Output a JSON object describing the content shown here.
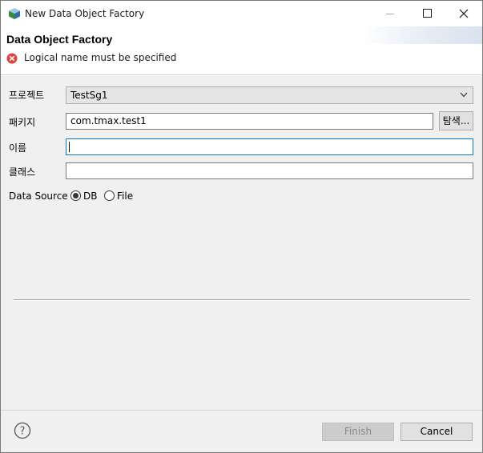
{
  "window": {
    "title": "New Data Object Factory",
    "app_icon": "cube-app-icon"
  },
  "header": {
    "title": "Data Object Factory",
    "message": "Logical name must be specified",
    "message_icon": "error-icon"
  },
  "form": {
    "project_label": "프로젝트",
    "project_value": "TestSg1",
    "package_label": "패키지",
    "package_value": "com.tmax.test1",
    "browse_label": "탐색...",
    "name_label": "이름",
    "name_value": "",
    "class_label": "클래스",
    "class_value": "",
    "data_source_label": "Data Source",
    "data_source_options": [
      "DB",
      "File"
    ],
    "data_source_selected": "DB"
  },
  "footer": {
    "help_icon": "help-icon",
    "finish_label": "Finish",
    "cancel_label": "Cancel"
  },
  "colors": {
    "focus_border": "#0078d7",
    "error_red": "#e04343",
    "dialog_bg": "#f0f0f0"
  }
}
